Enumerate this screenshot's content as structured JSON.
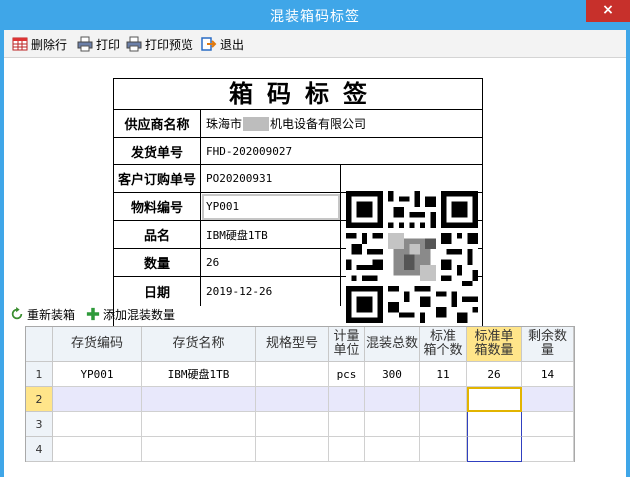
{
  "window": {
    "title": "混装箱码标签",
    "close": "×"
  },
  "toolbar": {
    "delete_row": "删除行",
    "print": "打印",
    "print_preview": "打印预览",
    "exit": "退出"
  },
  "label": {
    "title": "箱码标签",
    "fields": [
      {
        "key": "供应商名称",
        "value_prefix": "珠海市",
        "value_suffix": "机电设备有限公司"
      },
      {
        "key": "发货单号",
        "value": "FHD-202009027"
      },
      {
        "key": "客户订购单号",
        "value": "PO20200931"
      },
      {
        "key": "物料编号",
        "value": "YP001"
      },
      {
        "key": "品名",
        "value": "IBM硬盘1TB"
      },
      {
        "key": "数量",
        "value": "26"
      },
      {
        "key": "日期",
        "value": "2019-12-26"
      }
    ]
  },
  "actions": {
    "repack": "重新装箱",
    "add_mixed": "添加混装数量"
  },
  "grid": {
    "headers": [
      "存货编码",
      "存货名称",
      "规格型号",
      "计量\n单位",
      "混装总数",
      "标准\n箱个数",
      "标准单\n箱数量",
      "剩余数量"
    ],
    "row_numbers": [
      "1",
      "2",
      "3",
      "4"
    ],
    "rows": [
      [
        "YP001",
        "IBM硬盘1TB",
        "",
        "pcs",
        "300",
        "11",
        "26",
        "14"
      ]
    ]
  },
  "colors": {
    "titlebar": "#3fa6e8",
    "close": "#c7302b",
    "highlight": "#ffe58a",
    "current_row": "#e8e8fb"
  }
}
